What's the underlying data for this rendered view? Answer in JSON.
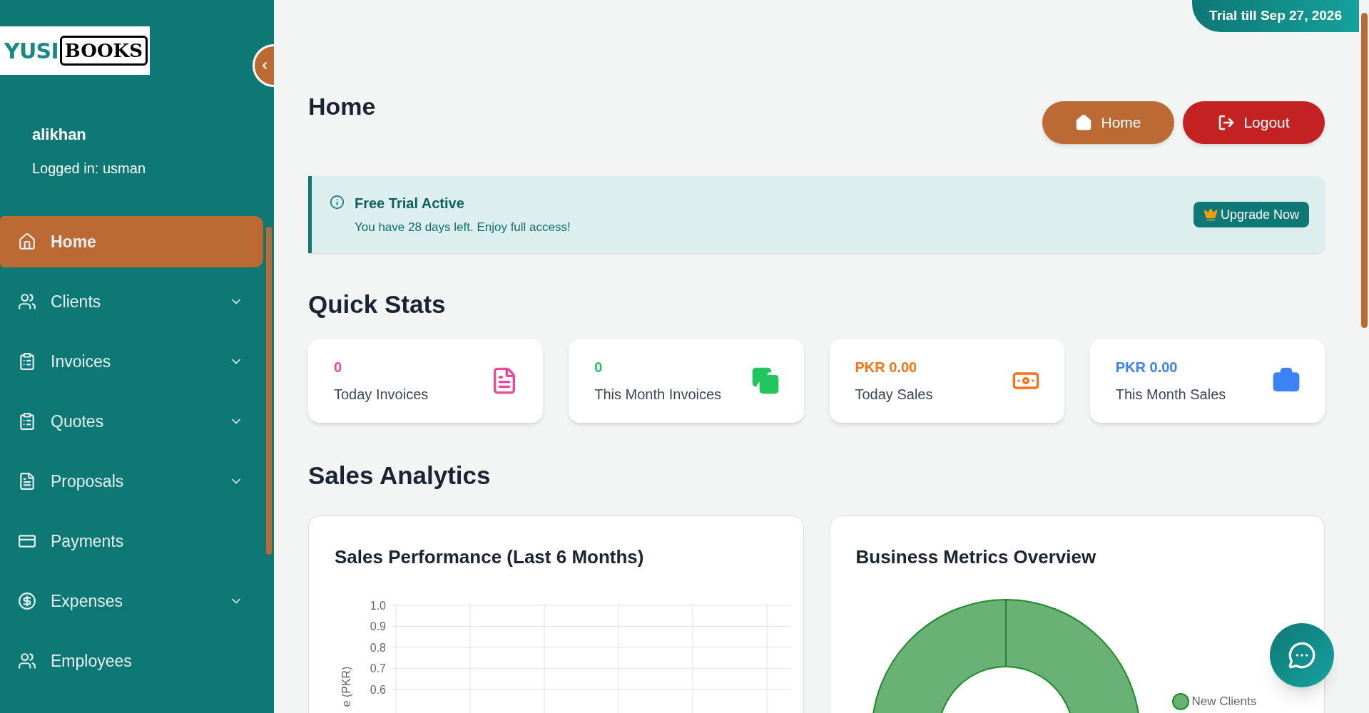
{
  "trial_badge": "Trial till Sep 27, 2026",
  "sidebar": {
    "logo": {
      "part_1": "YUSI",
      "part_2": "BOOKS"
    },
    "username": "alikhan",
    "logged_in": "Logged in: usman",
    "items": [
      {
        "label": "Home",
        "selected": true,
        "expandable": false
      },
      {
        "label": "Clients",
        "selected": false,
        "expandable": true
      },
      {
        "label": "Invoices",
        "selected": false,
        "expandable": true
      },
      {
        "label": "Quotes",
        "selected": false,
        "expandable": true
      },
      {
        "label": "Proposals",
        "selected": false,
        "expandable": true
      },
      {
        "label": "Payments",
        "selected": false,
        "expandable": false
      },
      {
        "label": "Expenses",
        "selected": false,
        "expandable": true
      },
      {
        "label": "Employees",
        "selected": false,
        "expandable": false
      }
    ]
  },
  "page": {
    "title": "Home",
    "buttons": [
      {
        "label": "Home",
        "kind": "home"
      },
      {
        "label": "Logout",
        "kind": "logout"
      }
    ]
  },
  "banner": {
    "title": "Free Trial Active",
    "message": "You have 28 days left. Enjoy full access!",
    "button": "Upgrade Now"
  },
  "quick_stats": {
    "title": "Quick Stats",
    "cards": [
      {
        "value": "0",
        "label": "Today Invoices",
        "color": "#ec4899"
      },
      {
        "value": "0",
        "label": "This Month Invoices",
        "color": "#22c55e"
      },
      {
        "value": "PKR 0.00",
        "label": "Today Sales",
        "color": "#f97316"
      },
      {
        "value": "PKR 0.00",
        "label": "This Month Sales",
        "color": "#3b82f6"
      }
    ]
  },
  "analytics": {
    "title": "Sales Analytics",
    "sales_chart": {
      "title": "Sales Performance (Last 6 Months)",
      "axis_title": "e (PKR)",
      "axis_ticks": [
        "1.0",
        "0.9",
        "0.8",
        "0.7",
        "0.6"
      ]
    },
    "metrics_chart": {
      "title": "Business Metrics Overview",
      "legend": [
        {
          "label": "New Clients",
          "color": "#6ab175"
        }
      ]
    }
  }
}
